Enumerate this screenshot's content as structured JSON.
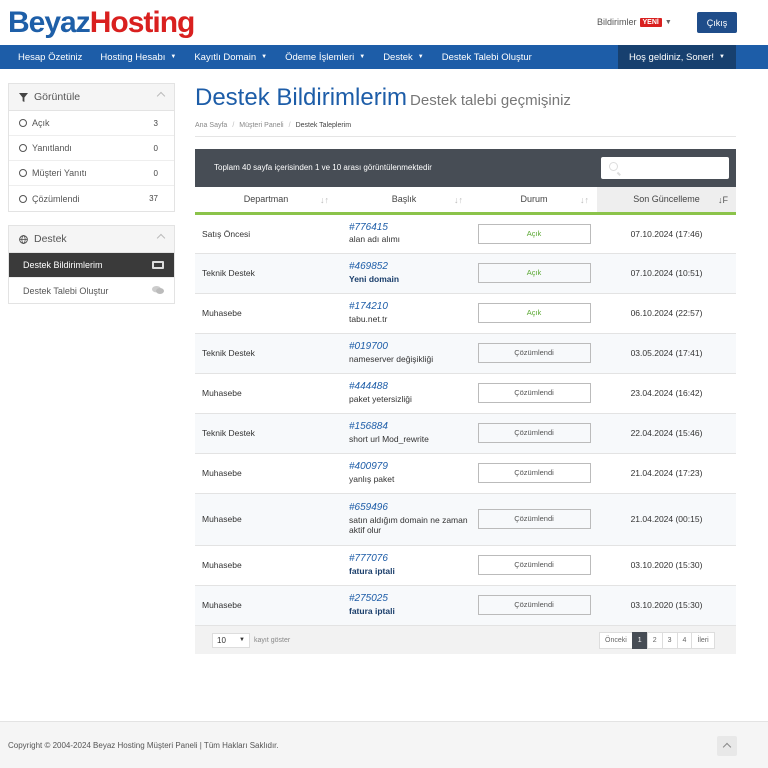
{
  "header": {
    "logo_part1": "Beyaz",
    "logo_part2": "Hosting",
    "notifications_label": "Bildirimler",
    "notifications_badge": "YENİ",
    "logout_label": "Çıkış"
  },
  "nav": {
    "items": [
      {
        "label": "Hesap Özetiniz",
        "caret": ""
      },
      {
        "label": "Hosting Hesabı",
        "caret": "▼"
      },
      {
        "label": "Kayıtlı Domain",
        "caret": "▼"
      },
      {
        "label": "Ödeme İşlemleri",
        "caret": "▼"
      },
      {
        "label": "Destek",
        "caret": "▼"
      },
      {
        "label": "Destek Talebi Oluştur",
        "caret": ""
      }
    ],
    "user_label": "Hoş geldiniz, Soner!"
  },
  "sidebar": {
    "filter_title": "Görüntüle",
    "filters": [
      {
        "label": "Açık",
        "count": "3"
      },
      {
        "label": "Yanıtlandı",
        "count": "0"
      },
      {
        "label": "Müşteri Yanıtı",
        "count": "0"
      },
      {
        "label": "Çözümlendi",
        "count": "37"
      }
    ],
    "support_title": "Destek",
    "support_links": [
      {
        "label": "Destek Bildirimlerim"
      },
      {
        "label": "Destek Talebi Oluştur"
      }
    ]
  },
  "page": {
    "title": "Destek Bildirimlerim",
    "subtitle": "Destek talebi geçmişiniz",
    "breadcrumb": [
      "Ana Sayfa",
      "Müşteri Paneli",
      "Destek Taleplerim"
    ]
  },
  "table": {
    "info": "Toplam 40 sayfa içerisinden 1 ve 10 arası görüntülenmektedir",
    "columns": [
      "Departman",
      "Başlık",
      "Durum",
      "Son Güncelleme"
    ],
    "rows": [
      {
        "dept": "Satış Öncesi",
        "id": "#776415",
        "title": "alan adı alımı",
        "status": "Açık",
        "updated": "07.10.2024 (17:46)"
      },
      {
        "dept": "Teknik Destek",
        "id": "#469852",
        "title": "Yeni domain",
        "status": "Açık",
        "updated": "07.10.2024 (10:51)"
      },
      {
        "dept": "Muhasebe",
        "id": "#174210",
        "title": "tabu.net.tr",
        "status": "Açık",
        "updated": "06.10.2024 (22:57)"
      },
      {
        "dept": "Teknik Destek",
        "id": "#019700",
        "title": "nameserver değişikliği",
        "status": "Çözümlendi",
        "updated": "03.05.2024 (17:41)"
      },
      {
        "dept": "Muhasebe",
        "id": "#444488",
        "title": "paket yetersizliği",
        "status": "Çözümlendi",
        "updated": "23.04.2024 (16:42)"
      },
      {
        "dept": "Teknik Destek",
        "id": "#156884",
        "title": "short url Mod_rewrite",
        "status": "Çözümlendi",
        "updated": "22.04.2024 (15:46)"
      },
      {
        "dept": "Muhasebe",
        "id": "#400979",
        "title": "yanlış paket",
        "status": "Çözümlendi",
        "updated": "21.04.2024 (17:23)"
      },
      {
        "dept": "Muhasebe",
        "id": "#659496",
        "title": "satın aldığım domain ne zaman aktif olur",
        "status": "Çözümlendi",
        "updated": "21.04.2024 (00:15)"
      },
      {
        "dept": "Muhasebe",
        "id": "#777076",
        "title": "fatura iptali",
        "status": "Çözümlendi",
        "updated": "03.10.2020 (15:30)"
      },
      {
        "dept": "Muhasebe",
        "id": "#275025",
        "title": "fatura iptali",
        "status": "Çözümlendi",
        "updated": "03.10.2020 (15:30)"
      }
    ],
    "page_size": "10",
    "page_size_label": "kayıt göster",
    "pager": [
      "Önceki",
      "1",
      "2",
      "3",
      "4",
      "İleri"
    ],
    "pager_active": "1"
  },
  "footer": {
    "text": "Copyright © 2004-2024 Beyaz Hosting Müşteri Paneli | Tüm Hakları Saklıdır."
  },
  "colors": {
    "brand_blue": "#1d5da8",
    "brand_red": "#d9201f",
    "status_open": "#5aa832",
    "table_accent": "#8bc34a"
  }
}
